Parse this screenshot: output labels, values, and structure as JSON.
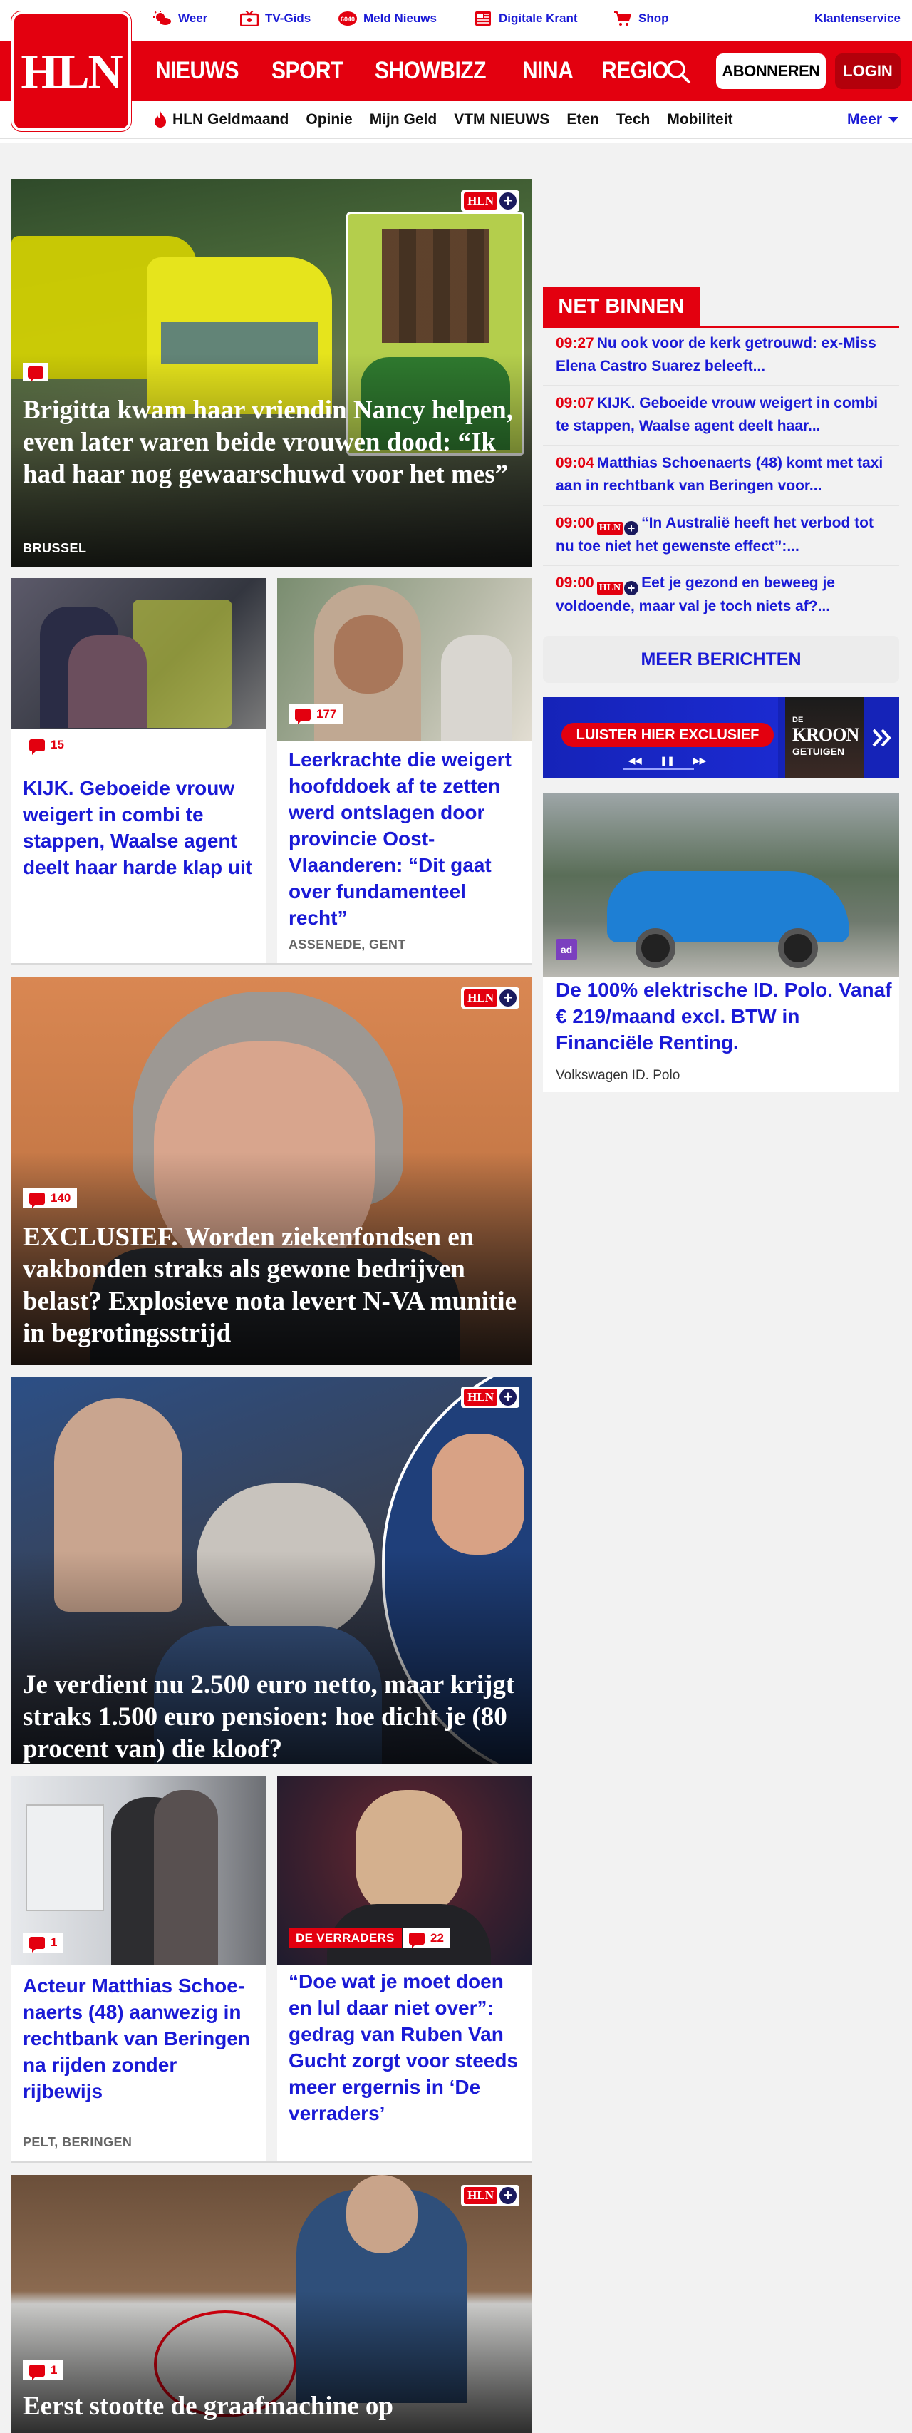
{
  "brand": {
    "logo": "HLN",
    "plus": "HLN+"
  },
  "services": [
    {
      "label": "Weer",
      "icon": "weather-icon"
    },
    {
      "label": "TV-Gids",
      "icon": "tv-icon"
    },
    {
      "label": "Meld Nieuws",
      "icon": "report-icon"
    },
    {
      "label": "Digitale Krant",
      "icon": "newspaper-icon"
    },
    {
      "label": "Shop",
      "icon": "cart-icon"
    }
  ],
  "klantenservice": "Klantenservice",
  "main_nav": [
    "NIEUWS",
    "SPORT",
    "SHOWBIZZ",
    "NINA",
    "REGIO"
  ],
  "abonneren": "ABONNEREN",
  "login": "LOGIN",
  "sub_nav": [
    "HLN Geldmaand",
    "Opinie",
    "Mijn Geld",
    "VTM NIEUWS",
    "Eten",
    "Tech",
    "Mobiliteit"
  ],
  "meer": "Meer",
  "articles": {
    "a1": {
      "title": "Brigitta kwam haar vriendin Nancy helpen, even later waren beide vrouwen dood: “Ik had haar nog gewaarschuwd voor het mes”",
      "location": "BRUSSEL"
    },
    "a2": {
      "title": "KIJK. Geboeide vrouw weigert in combi te stappen, Waalse agent deelt haar harde klap uit",
      "comments": "15"
    },
    "a3": {
      "title": "Leerkrachte die weigert hoofddoek af te zetten werd ontslagen door provincie Oost-Vlaanderen: “Dit gaat over fundamenteel recht”",
      "comments": "177",
      "location": "ASSENEDE, GENT"
    },
    "a4": {
      "title": "EXCLUSIEF. Worden ziekenfondsen en vakbonden straks als gewone bedrijven belast? Explosieve nota levert N-VA munitie in begrotingsstrijd",
      "comments": "140"
    },
    "a5": {
      "title": "Je verdient nu 2.500 euro netto, maar krijgt straks 1.500 euro pensioen: hoe dicht je (80 procent van) die kloof?"
    },
    "a6": {
      "title": "Acteur Matthias Schoe­naerts (48) aanwezig in rechtbank van Beringen na rijden zonder rijbewijs",
      "comments": "1",
      "location": "PELT, BERINGEN"
    },
    "a7": {
      "title": "“Doe wat je moet doen en lul daar niet over”: gedrag van Ruben Van Gucht zorgt voor steeds meer ergernis in ‘De verraders’",
      "comments": "22",
      "tag": "DE VERRADERS"
    },
    "a8": {
      "title": "Eerst stootte de graafmachine op",
      "comments": "1"
    }
  },
  "net_binnen": {
    "heading": "NET BINNEN",
    "items": [
      {
        "time": "09:27",
        "text": "Nu ook voor de kerk getrouwd: ex-Miss Elena Castro Suarez beleeft...",
        "plus": false
      },
      {
        "time": "09:07",
        "text": "KIJK. Geboeide vrouw weigert in combi te stappen, Waalse agent deelt haar...",
        "plus": false
      },
      {
        "time": "09:04",
        "text": "Matthias Schoenaerts (48) komt met taxi aan in rechtbank van Beringen voor...",
        "plus": false
      },
      {
        "time": "09:00",
        "text": "“In Australië heeft het verbod tot nu toe niet het gewenste effect”:...",
        "plus": true
      },
      {
        "time": "09:00",
        "text": "Eet je gezond en beweeg je voldoende, maar val je toch niets af?...",
        "plus": true
      }
    ],
    "more": "MEER BERICHTEN"
  },
  "podcast": {
    "button": "LUISTER HIER EXCLUSIEF",
    "logo_top": "DE",
    "logo_main": "KROON",
    "logo_sub": "GETUIGEN"
  },
  "ad": {
    "title": "De 100% elektrische ID. Polo. Vanaf € 219/maand excl. BTW in Financiële Renting.",
    "advertiser": "Volkswagen ID. Polo",
    "badge": "ad"
  }
}
